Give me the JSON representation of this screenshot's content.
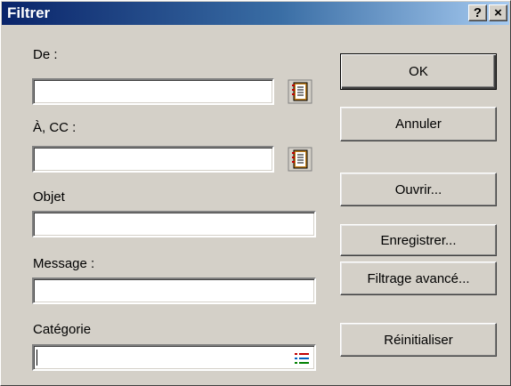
{
  "window": {
    "title": "Filtrer"
  },
  "titlebar": {
    "help": "?",
    "close": "×"
  },
  "fields": {
    "de": {
      "label": "De :",
      "value": ""
    },
    "a_cc": {
      "label": "À, CC :",
      "value": ""
    },
    "objet": {
      "label": "Objet",
      "value": ""
    },
    "message": {
      "label": "Message :",
      "value": ""
    },
    "categorie": {
      "label": "Catégorie",
      "value": ""
    }
  },
  "buttons": {
    "ok": "OK",
    "annuler": "Annuler",
    "ouvrir": "Ouvrir...",
    "enregistrer": "Enregistrer...",
    "filtrage_avance": "Filtrage avancé...",
    "reinitialiser": "Réinitialiser"
  },
  "icons": {
    "address_book": "address-book-icon",
    "category_list": "category-list-icon"
  },
  "colors": {
    "title_bar": "#0a246a",
    "face": "#d4d0c8"
  }
}
